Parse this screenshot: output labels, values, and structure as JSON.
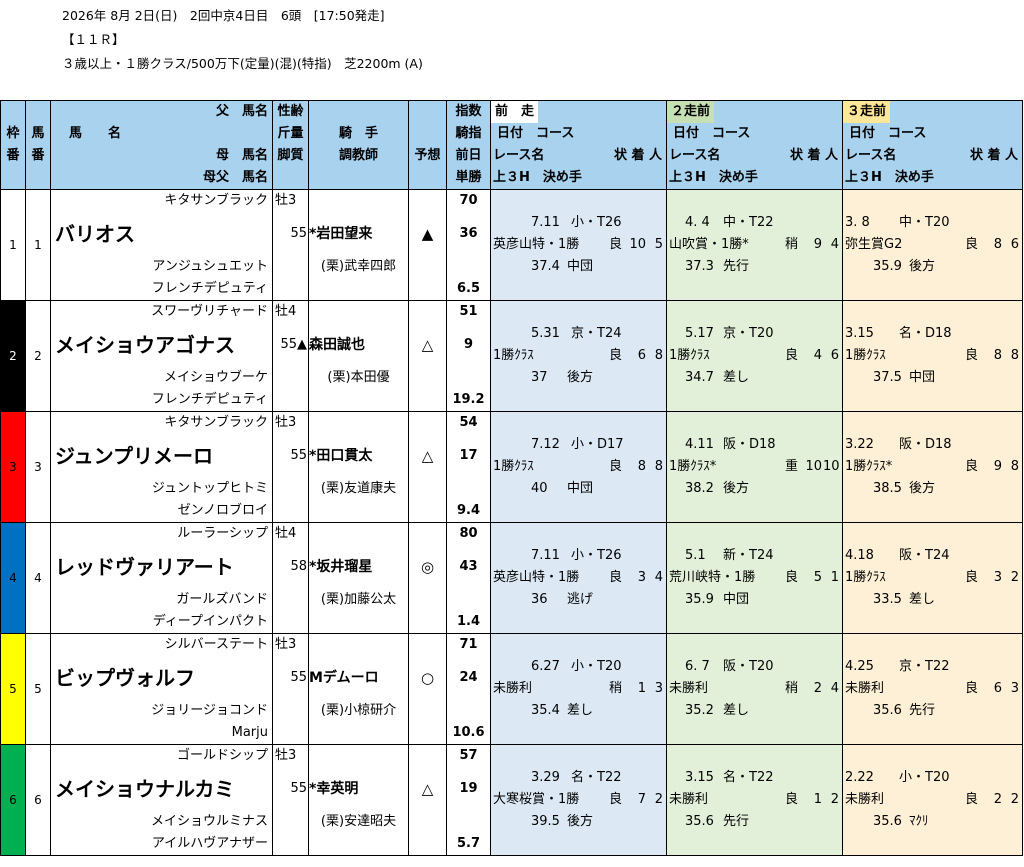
{
  "header": {
    "line1": "2026年 8月 2日(日)　2回中京4日目　6頭　[17:50発走]",
    "line2": "【１１Ｒ】",
    "line3": "３歳以上・１勝クラス/500万下(定量)(混)(特指)　芝2200m (A)"
  },
  "col_headers": {
    "waku": [
      "枠",
      "番"
    ],
    "uma": [
      "馬",
      "番"
    ],
    "name1": "父　馬名",
    "name2": "馬　　名",
    "name3": "母　馬名",
    "name4": "母父　馬名",
    "sex1": "性齢",
    "sex2": "斤量",
    "sex3": "脚質",
    "jockey1": "騎　手",
    "jockey2": "調教師",
    "yoso": "予想",
    "idx1": "指数",
    "idx2": "騎指",
    "idx3": "前日",
    "idx4": "単勝",
    "race_labels": [
      "前　走",
      "２走前",
      "３走前"
    ],
    "race_sub1": "日付　コース",
    "race_sub2a": "レース名",
    "race_sub2b": "状 着 人",
    "race_sub3": "上３H　決め手"
  },
  "waku_colors": [
    "#ffffff",
    "#000000",
    "#ff0000",
    "#0070c0",
    "#ffff00",
    "#00b050"
  ],
  "waku_text_colors": [
    "#000000",
    "#ffffff",
    "#000000",
    "#000000",
    "#000000",
    "#000000"
  ],
  "horses": [
    {
      "waku": "1",
      "uma": "1",
      "sire": "キタサンブラック",
      "name": "バリオス",
      "dam": "アンジュシュエット",
      "damsire": "フレンチデピュティ",
      "sex": "牡3",
      "weight": "55",
      "weight_mark": "*",
      "jockey": "岩田望来",
      "style": "",
      "trainer": "(栗)武幸四郎",
      "mark": "▲",
      "idx": "70",
      "jidx": "36",
      "prev": "",
      "odds": "6.5",
      "races": [
        {
          "date": "7.11",
          "course": "小・T26",
          "race": "英彦山特・1勝",
          "cond": "良",
          "pos": "10",
          "pop": "5",
          "l3": "37.4",
          "kime": "中団"
        },
        {
          "date": "4. 4",
          "course": "中・T22",
          "race": "山吹賞・1勝*",
          "cond": "稍",
          "pos": "9",
          "pop": "4",
          "l3": "37.3",
          "kime": "先行"
        },
        {
          "date": "3. 8",
          "course": "中・T20",
          "race": "弥生賞G2",
          "cond": "良",
          "pos": "8",
          "pop": "6",
          "l3": "35.9",
          "kime": "後方"
        }
      ]
    },
    {
      "waku": "2",
      "uma": "2",
      "sire": "スワーヴリチャード",
      "name": "メイショウアゴナス",
      "dam": "メイショウブーケ",
      "damsire": "フレンチデピュティ",
      "sex": "牡4",
      "weight": "55▲",
      "weight_mark": "",
      "jockey": "森田誠也",
      "style": "",
      "trainer": "(栗)本田優",
      "mark": "△",
      "idx": "51",
      "jidx": "9",
      "prev": "",
      "odds": "19.2",
      "races": [
        {
          "date": "5.31",
          "course": "京・T24",
          "race": "1勝ｸﾗｽ",
          "cond": "良",
          "pos": "6",
          "pop": "8",
          "l3": "37",
          "kime": "後方"
        },
        {
          "date": "5.17",
          "course": "京・T20",
          "race": "1勝ｸﾗｽ",
          "cond": "良",
          "pos": "4",
          "pop": "6",
          "l3": "34.7",
          "kime": "差し"
        },
        {
          "date": "3.15",
          "course": "名・D18",
          "race": "1勝ｸﾗｽ",
          "cond": "良",
          "pos": "8",
          "pop": "8",
          "l3": "37.5",
          "kime": "中団"
        }
      ]
    },
    {
      "waku": "3",
      "uma": "3",
      "sire": "キタサンブラック",
      "name": "ジュンプリメーロ",
      "dam": "ジュントップヒトミ",
      "damsire": "ゼンノロブロイ",
      "sex": "牡3",
      "weight": "55",
      "weight_mark": "*",
      "jockey": "田口貫太",
      "style": "",
      "trainer": "(栗)友道康夫",
      "mark": "△",
      "idx": "54",
      "jidx": "17",
      "prev": "",
      "odds": "9.4",
      "races": [
        {
          "date": "7.12",
          "course": "小・D17",
          "race": "1勝ｸﾗｽ",
          "cond": "良",
          "pos": "8",
          "pop": "8",
          "l3": "40",
          "kime": "中団"
        },
        {
          "date": "4.11",
          "course": "阪・D18",
          "race": "1勝ｸﾗｽ*",
          "cond": "重",
          "pos": "10",
          "pop": "10",
          "l3": "38.2",
          "kime": "後方"
        },
        {
          "date": "3.22",
          "course": "阪・D18",
          "race": "1勝ｸﾗｽ*",
          "cond": "良",
          "pos": "9",
          "pop": "8",
          "l3": "38.5",
          "kime": "後方"
        }
      ]
    },
    {
      "waku": "4",
      "uma": "4",
      "sire": "ルーラーシップ",
      "name": "レッドヴァリアート",
      "dam": "ガールズバンド",
      "damsire": "ディープインパクト",
      "sex": "牡4",
      "weight": "58",
      "weight_mark": "*",
      "jockey": "坂井瑠星",
      "style": "",
      "trainer": "(栗)加藤公太",
      "mark": "◎",
      "idx": "80",
      "jidx": "43",
      "prev": "",
      "odds": "1.4",
      "races": [
        {
          "date": "7.11",
          "course": "小・T26",
          "race": "英彦山特・1勝",
          "cond": "良",
          "pos": "3",
          "pop": "4",
          "l3": "36",
          "kime": "逃げ"
        },
        {
          "date": "5.1",
          "course": "新・T24",
          "race": "荒川峡特・1勝",
          "cond": "良",
          "pos": "5",
          "pop": "1",
          "l3": "35.9",
          "kime": "中団"
        },
        {
          "date": "4.18",
          "course": "阪・T24",
          "race": "1勝ｸﾗｽ",
          "cond": "良",
          "pos": "3",
          "pop": "2",
          "l3": "33.5",
          "kime": "差し"
        }
      ]
    },
    {
      "waku": "5",
      "uma": "5",
      "sire": "シルバーステート",
      "name": "ビップヴォルフ",
      "dam": "ジョリージョコンド",
      "damsire": "Marju",
      "sex": "牡3",
      "weight": "55",
      "weight_mark": "",
      "jockey": "Mデムーロ",
      "style": "",
      "trainer": "(栗)小椋研介",
      "mark": "○",
      "idx": "71",
      "jidx": "24",
      "prev": "",
      "odds": "10.6",
      "races": [
        {
          "date": "6.27",
          "course": "小・T20",
          "race": "未勝利",
          "cond": "稍",
          "pos": "1",
          "pop": "3",
          "l3": "35.4",
          "kime": "差し"
        },
        {
          "date": "6. 7",
          "course": "阪・T20",
          "race": "未勝利",
          "cond": "稍",
          "pos": "2",
          "pop": "4",
          "l3": "35.2",
          "kime": "差し"
        },
        {
          "date": "4.25",
          "course": "京・T22",
          "race": "未勝利",
          "cond": "良",
          "pos": "6",
          "pop": "3",
          "l3": "35.6",
          "kime": "先行"
        }
      ]
    },
    {
      "waku": "6",
      "uma": "6",
      "sire": "ゴールドシップ",
      "name": "メイショウナルカミ",
      "dam": "メイショウルミナス",
      "damsire": "アイルハヴアナザー",
      "sex": "牡3",
      "weight": "55",
      "weight_mark": "*",
      "jockey": "幸英明",
      "style": "",
      "trainer": "(栗)安達昭夫",
      "mark": "△",
      "idx": "57",
      "jidx": "19",
      "prev": "",
      "odds": "5.7",
      "races": [
        {
          "date": "3.29",
          "course": "名・T22",
          "race": "大寒桜賞・1勝",
          "cond": "良",
          "pos": "7",
          "pop": "2",
          "l3": "39.5",
          "kime": "後方"
        },
        {
          "date": "3.15",
          "course": "名・T22",
          "race": "未勝利",
          "cond": "良",
          "pos": "1",
          "pop": "2",
          "l3": "35.6",
          "kime": "先行"
        },
        {
          "date": "2.22",
          "course": "小・T20",
          "race": "未勝利",
          "cond": "良",
          "pos": "2",
          "pop": "2",
          "l3": "35.6",
          "kime": "ﾏｸﾘ"
        }
      ]
    }
  ]
}
